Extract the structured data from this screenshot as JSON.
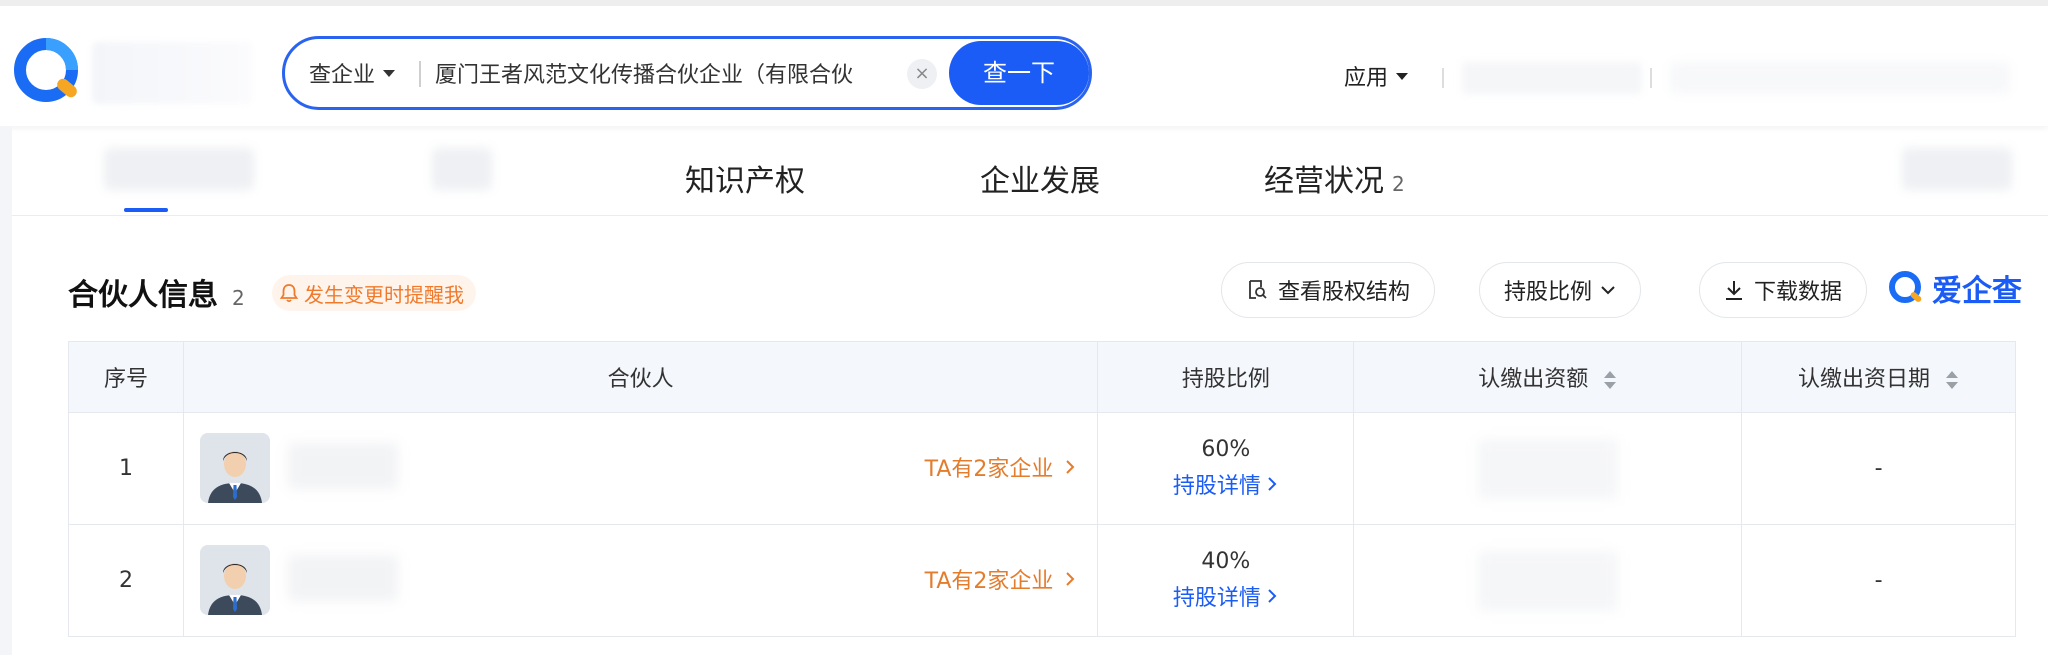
{
  "header": {
    "search": {
      "type_label": "查企业",
      "value": "厦门王者风范文化传播合伙企业（有限合伙",
      "clear_glyph": "×",
      "button_label": "查一下"
    },
    "nav": {
      "apps_label": "应用"
    }
  },
  "tabs": [
    {
      "label": "知识产权",
      "count": ""
    },
    {
      "label": "企业发展",
      "count": ""
    },
    {
      "label": "经营状况",
      "count": "2"
    }
  ],
  "section": {
    "title": "合伙人信息",
    "count": "2",
    "remind_label": "发生变更时提醒我",
    "actions": {
      "equity_structure": "查看股权结构",
      "ratio_filter": "持股比例",
      "download": "下载数据"
    },
    "brand_label": "爱企查"
  },
  "table": {
    "headers": [
      "序号",
      "合伙人",
      "持股比例",
      "认缴出资额",
      "认缴出资日期"
    ],
    "rows": [
      {
        "index": "1",
        "enterprise_link": "TA有2家企业",
        "ratio": "60%",
        "ratio_detail": "持股详情",
        "date": "-"
      },
      {
        "index": "2",
        "enterprise_link": "TA有2家企业",
        "ratio": "40%",
        "ratio_detail": "持股详情",
        "date": "-"
      }
    ]
  },
  "colors": {
    "accent": "#1a5cf5",
    "orange": "#e37d2e",
    "header_bg": "#f4f7fc"
  }
}
